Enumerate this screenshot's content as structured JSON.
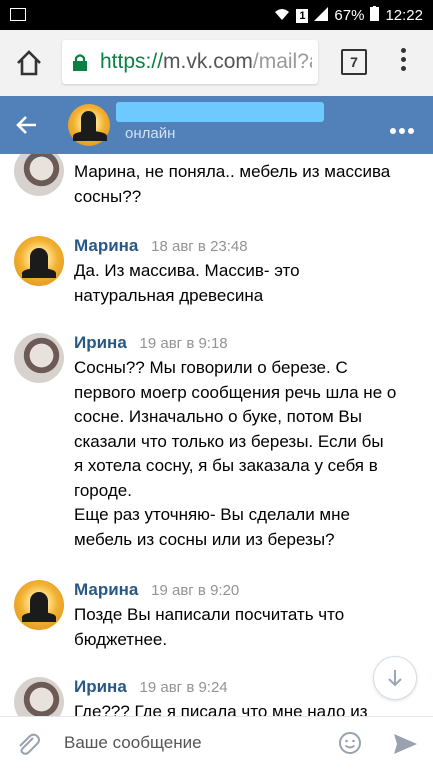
{
  "status_bar": {
    "battery": "67%",
    "time": "12:22",
    "sim_badge": "1"
  },
  "browser": {
    "url_scheme": "https://",
    "url_host": "m.vk.com",
    "url_path": "/mail?a",
    "tab_count": "7"
  },
  "chat_header": {
    "status": "онлайн"
  },
  "messages": [
    {
      "author": "",
      "time": "",
      "lines": [
        "Марина, не поняла.. мебель из массива",
        "сосны??"
      ],
      "avatar": "irina"
    },
    {
      "author": "Марина",
      "time": "18 авг в 23:48",
      "lines": [
        "Да. Из массива. Массив- это",
        "натуральная древесина"
      ],
      "avatar": "marina"
    },
    {
      "author": "Ирина",
      "time": "19 авг в 9:18",
      "lines": [
        "Сосны?? Мы говорили о березе. С",
        "первого моегр сообщения речь шла не о",
        "сосне. Изначально о буке, потом Вы",
        "сказали что только из березы. Если бы",
        "я хотела сосну, я бы заказала у себя в",
        "городе.",
        "Еще раз уточняю- Вы сделали мне",
        "мебель из сосны или из березы?"
      ],
      "avatar": "irina"
    },
    {
      "author": "Марина",
      "time": "19 авг в 9:20",
      "lines": [
        "Позде Вы написали посчитать что",
        "бюджетнее."
      ],
      "avatar": "marina"
    },
    {
      "author": "Ирина",
      "time": "19 авг в 9:24",
      "lines": [
        "Где??? Где я писала что мне надо из"
      ],
      "avatar": "irina"
    }
  ],
  "composer": {
    "placeholder": "Ваше сообщение"
  },
  "colors": {
    "header_blue": "#5181b8",
    "author_blue": "#2a5885",
    "secure_green": "#0b8043"
  }
}
